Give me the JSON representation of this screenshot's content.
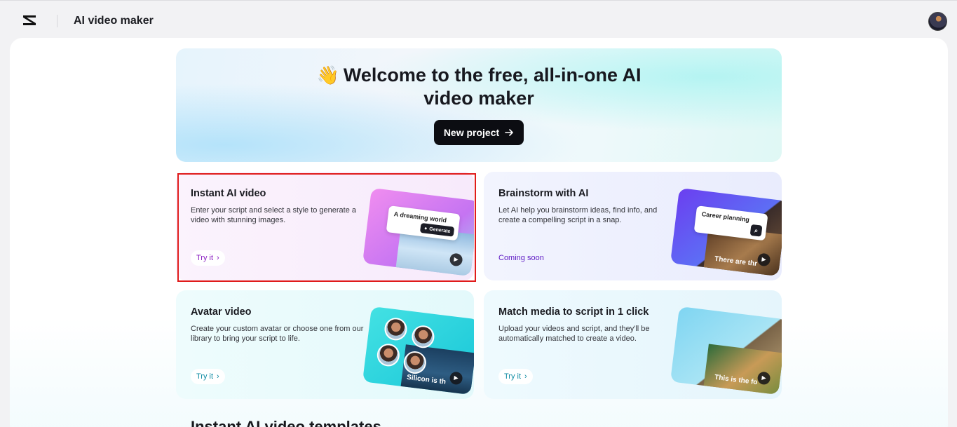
{
  "header": {
    "app_title": "AI video maker",
    "logo_icon": "capcut-logo-icon",
    "avatar_icon": "user-avatar"
  },
  "hero": {
    "emoji": "👋",
    "title_line1": "Welcome to the free, all-in-one AI",
    "title_line2": "video maker",
    "new_project_label": "New project",
    "new_project_icon": "arrow-right-icon"
  },
  "cards": [
    {
      "title": "Instant AI video",
      "description": "Enter your script and select a style to generate a video with stunning images.",
      "action_label": "Try it",
      "thumb_chip_text": "A dreaming world",
      "thumb_chip_button": "Generate"
    },
    {
      "title": "Brainstorm with AI",
      "description": "Let AI help you brainstorm ideas, find info, and create a compelling script in a snap.",
      "status_label": "Coming soon",
      "thumb_chip_text": "Career planning",
      "thumb_overlay_text": "There are thr"
    },
    {
      "title": "Avatar video",
      "description": "Create your custom avatar or choose one from our library to bring your script to life.",
      "action_label": "Try it",
      "thumb_overlay_text": "Silicon is th"
    },
    {
      "title": "Match media to script in 1 click",
      "description": "Upload your videos and script, and they'll be automatically matched to create a video.",
      "action_label": "Try it",
      "thumb_overlay_text": "This is the fo"
    }
  ],
  "next_section_peek": "Instant AI video templates",
  "colors": {
    "page_bg": "#f2f2f4",
    "primary_button": "#0c0d12",
    "try_purple": "#8a1cc2",
    "try_teal": "#0f8ca3",
    "coming_soon": "#5d18c4",
    "selection_outline": "#e01b1b"
  }
}
